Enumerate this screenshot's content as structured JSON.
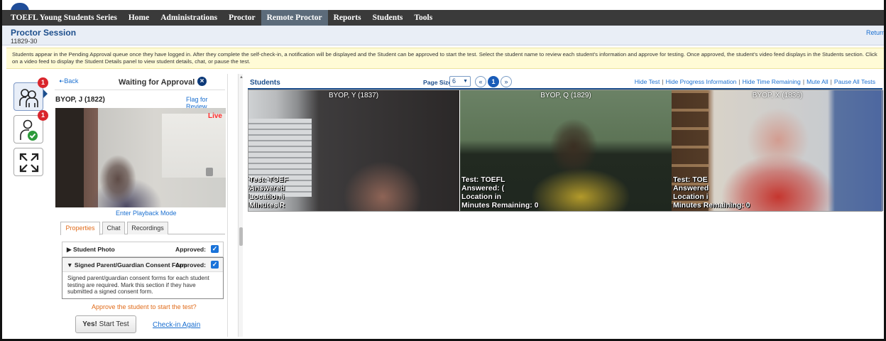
{
  "nav": {
    "brand": "TOEFL Young Students Series",
    "items": [
      "Home",
      "Administrations",
      "Proctor",
      "Remote Proctor",
      "Reports",
      "Students",
      "Tools"
    ]
  },
  "session": {
    "title": "Proctor Session",
    "id": "11829-30",
    "return_link": "Return"
  },
  "notice": "Students appear in the Pending Approval queue once they have logged in. After they complete the self-check-in, a notification will be displayed and the Student can be approved to start the test. Select the student name to review each student's information and approve for testing. Once approved, the student's video feed displays in the Students section. Click on a video feed to display the Student Details panel to view student details, chat, or pause the test.",
  "sidebar": {
    "buttons": [
      {
        "icon": "group-icon",
        "badge": "1"
      },
      {
        "icon": "user-approved-icon",
        "badge": "1"
      },
      {
        "icon": "expand-icon"
      }
    ]
  },
  "panel": {
    "back": "Back",
    "title": "Waiting for Approval",
    "student_name": "BYOP, J (1822)",
    "flag_review": "Flag for Review",
    "live": "Live",
    "playback": "Enter Playback Mode",
    "tabs": [
      "Properties",
      "Chat",
      "Recordings"
    ],
    "photo_section": {
      "label": "Student Photo",
      "approved": "Approved:"
    },
    "consent_section": {
      "label": "Signed Parent/Guardian Consent Form",
      "approved": "Approved:",
      "body": "Signed parent/guardian consent forms for each student testing are required. Mark this section if they have submitted a signed consent form."
    },
    "approve_question": "Approve the student to start the test?",
    "start_prefix": "Yes!",
    "start_suffix": "Start Test",
    "checkin_again": "Check-in Again"
  },
  "students": {
    "title": "Students",
    "page_size_label": "Page Size:",
    "page_size_value": "6",
    "page_first": "«",
    "page_current": "1",
    "page_last": "»",
    "actions": [
      "Hide Test",
      "Hide Progress Information",
      "Hide Time Remaining",
      "Mute All",
      "Pause All Tests"
    ],
    "feeds": [
      {
        "name": "BYOP, Y (1837)",
        "test": "Test: TOEF",
        "answered": "Answered",
        "location": "Location i",
        "minutes": "Minutes R"
      },
      {
        "name": "BYOP, Q (1829)",
        "test": "Test: TOEFL",
        "answered": "Answered: (",
        "location": "Location in",
        "minutes": "Minutes Remaining: 0"
      },
      {
        "name": "BYOP, X (1836)",
        "test": "Test: TOE",
        "answered": "Answered",
        "location": "Location i",
        "minutes": "Minutes Remaining: 0"
      }
    ]
  },
  "colors": {
    "nav_bg": "#3a3a3a",
    "accent_blue": "#1c4e8c",
    "link_blue": "#1a6fd0",
    "orange": "#e06b1a",
    "badge_red": "#d9252c",
    "live_red": "#ff2a2a",
    "notice_bg": "#fffbd6"
  }
}
